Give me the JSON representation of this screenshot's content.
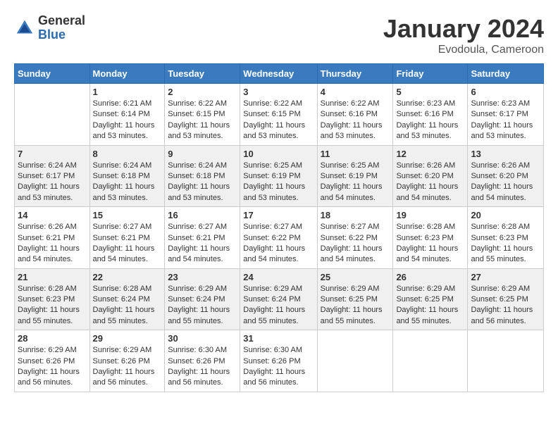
{
  "header": {
    "logo_general": "General",
    "logo_blue": "Blue",
    "title": "January 2024",
    "subtitle": "Evodoula, Cameroon"
  },
  "columns": [
    "Sunday",
    "Monday",
    "Tuesday",
    "Wednesday",
    "Thursday",
    "Friday",
    "Saturday"
  ],
  "weeks": [
    [
      {
        "day": "",
        "sunrise": "",
        "sunset": "",
        "daylight": ""
      },
      {
        "day": "1",
        "sunrise": "Sunrise: 6:21 AM",
        "sunset": "Sunset: 6:14 PM",
        "daylight": "Daylight: 11 hours and 53 minutes."
      },
      {
        "day": "2",
        "sunrise": "Sunrise: 6:22 AM",
        "sunset": "Sunset: 6:15 PM",
        "daylight": "Daylight: 11 hours and 53 minutes."
      },
      {
        "day": "3",
        "sunrise": "Sunrise: 6:22 AM",
        "sunset": "Sunset: 6:15 PM",
        "daylight": "Daylight: 11 hours and 53 minutes."
      },
      {
        "day": "4",
        "sunrise": "Sunrise: 6:22 AM",
        "sunset": "Sunset: 6:16 PM",
        "daylight": "Daylight: 11 hours and 53 minutes."
      },
      {
        "day": "5",
        "sunrise": "Sunrise: 6:23 AM",
        "sunset": "Sunset: 6:16 PM",
        "daylight": "Daylight: 11 hours and 53 minutes."
      },
      {
        "day": "6",
        "sunrise": "Sunrise: 6:23 AM",
        "sunset": "Sunset: 6:17 PM",
        "daylight": "Daylight: 11 hours and 53 minutes."
      }
    ],
    [
      {
        "day": "7",
        "sunrise": "Sunrise: 6:24 AM",
        "sunset": "Sunset: 6:17 PM",
        "daylight": "Daylight: 11 hours and 53 minutes."
      },
      {
        "day": "8",
        "sunrise": "Sunrise: 6:24 AM",
        "sunset": "Sunset: 6:18 PM",
        "daylight": "Daylight: 11 hours and 53 minutes."
      },
      {
        "day": "9",
        "sunrise": "Sunrise: 6:24 AM",
        "sunset": "Sunset: 6:18 PM",
        "daylight": "Daylight: 11 hours and 53 minutes."
      },
      {
        "day": "10",
        "sunrise": "Sunrise: 6:25 AM",
        "sunset": "Sunset: 6:19 PM",
        "daylight": "Daylight: 11 hours and 53 minutes."
      },
      {
        "day": "11",
        "sunrise": "Sunrise: 6:25 AM",
        "sunset": "Sunset: 6:19 PM",
        "daylight": "Daylight: 11 hours and 54 minutes."
      },
      {
        "day": "12",
        "sunrise": "Sunrise: 6:26 AM",
        "sunset": "Sunset: 6:20 PM",
        "daylight": "Daylight: 11 hours and 54 minutes."
      },
      {
        "day": "13",
        "sunrise": "Sunrise: 6:26 AM",
        "sunset": "Sunset: 6:20 PM",
        "daylight": "Daylight: 11 hours and 54 minutes."
      }
    ],
    [
      {
        "day": "14",
        "sunrise": "Sunrise: 6:26 AM",
        "sunset": "Sunset: 6:21 PM",
        "daylight": "Daylight: 11 hours and 54 minutes."
      },
      {
        "day": "15",
        "sunrise": "Sunrise: 6:27 AM",
        "sunset": "Sunset: 6:21 PM",
        "daylight": "Daylight: 11 hours and 54 minutes."
      },
      {
        "day": "16",
        "sunrise": "Sunrise: 6:27 AM",
        "sunset": "Sunset: 6:21 PM",
        "daylight": "Daylight: 11 hours and 54 minutes."
      },
      {
        "day": "17",
        "sunrise": "Sunrise: 6:27 AM",
        "sunset": "Sunset: 6:22 PM",
        "daylight": "Daylight: 11 hours and 54 minutes."
      },
      {
        "day": "18",
        "sunrise": "Sunrise: 6:27 AM",
        "sunset": "Sunset: 6:22 PM",
        "daylight": "Daylight: 11 hours and 54 minutes."
      },
      {
        "day": "19",
        "sunrise": "Sunrise: 6:28 AM",
        "sunset": "Sunset: 6:23 PM",
        "daylight": "Daylight: 11 hours and 54 minutes."
      },
      {
        "day": "20",
        "sunrise": "Sunrise: 6:28 AM",
        "sunset": "Sunset: 6:23 PM",
        "daylight": "Daylight: 11 hours and 55 minutes."
      }
    ],
    [
      {
        "day": "21",
        "sunrise": "Sunrise: 6:28 AM",
        "sunset": "Sunset: 6:23 PM",
        "daylight": "Daylight: 11 hours and 55 minutes."
      },
      {
        "day": "22",
        "sunrise": "Sunrise: 6:28 AM",
        "sunset": "Sunset: 6:24 PM",
        "daylight": "Daylight: 11 hours and 55 minutes."
      },
      {
        "day": "23",
        "sunrise": "Sunrise: 6:29 AM",
        "sunset": "Sunset: 6:24 PM",
        "daylight": "Daylight: 11 hours and 55 minutes."
      },
      {
        "day": "24",
        "sunrise": "Sunrise: 6:29 AM",
        "sunset": "Sunset: 6:24 PM",
        "daylight": "Daylight: 11 hours and 55 minutes."
      },
      {
        "day": "25",
        "sunrise": "Sunrise: 6:29 AM",
        "sunset": "Sunset: 6:25 PM",
        "daylight": "Daylight: 11 hours and 55 minutes."
      },
      {
        "day": "26",
        "sunrise": "Sunrise: 6:29 AM",
        "sunset": "Sunset: 6:25 PM",
        "daylight": "Daylight: 11 hours and 55 minutes."
      },
      {
        "day": "27",
        "sunrise": "Sunrise: 6:29 AM",
        "sunset": "Sunset: 6:25 PM",
        "daylight": "Daylight: 11 hours and 56 minutes."
      }
    ],
    [
      {
        "day": "28",
        "sunrise": "Sunrise: 6:29 AM",
        "sunset": "Sunset: 6:26 PM",
        "daylight": "Daylight: 11 hours and 56 minutes."
      },
      {
        "day": "29",
        "sunrise": "Sunrise: 6:29 AM",
        "sunset": "Sunset: 6:26 PM",
        "daylight": "Daylight: 11 hours and 56 minutes."
      },
      {
        "day": "30",
        "sunrise": "Sunrise: 6:30 AM",
        "sunset": "Sunset: 6:26 PM",
        "daylight": "Daylight: 11 hours and 56 minutes."
      },
      {
        "day": "31",
        "sunrise": "Sunrise: 6:30 AM",
        "sunset": "Sunset: 6:26 PM",
        "daylight": "Daylight: 11 hours and 56 minutes."
      },
      {
        "day": "",
        "sunrise": "",
        "sunset": "",
        "daylight": ""
      },
      {
        "day": "",
        "sunrise": "",
        "sunset": "",
        "daylight": ""
      },
      {
        "day": "",
        "sunrise": "",
        "sunset": "",
        "daylight": ""
      }
    ]
  ]
}
